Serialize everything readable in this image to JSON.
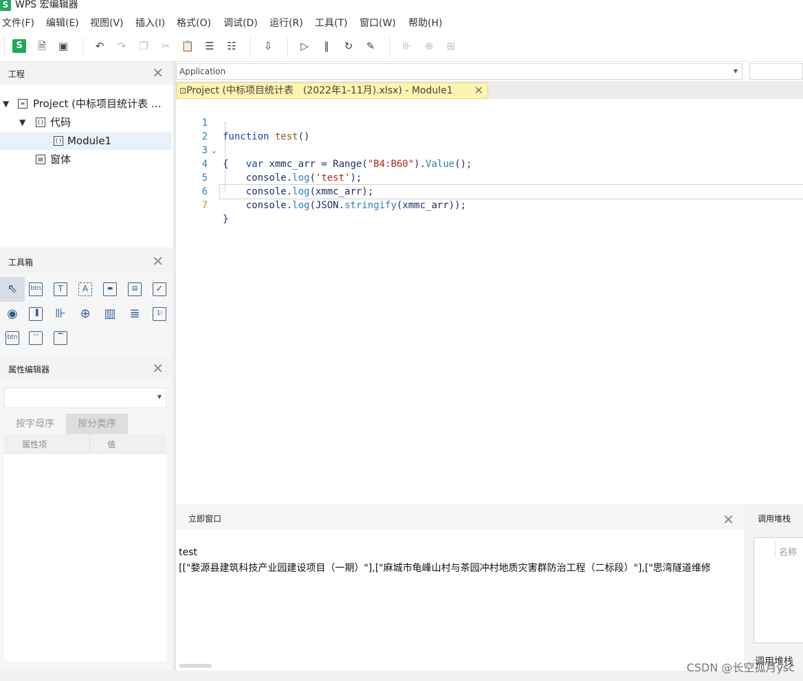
{
  "app": {
    "logo": "S",
    "title": "WPS 宏编辑器"
  },
  "menu": [
    {
      "label": "文件(F)"
    },
    {
      "label": "编辑(E)"
    },
    {
      "label": "视图(V)"
    },
    {
      "label": "插入(I)"
    },
    {
      "label": "格式(O)"
    },
    {
      "label": "调试(D)"
    },
    {
      "label": "运行(R)"
    },
    {
      "label": "工具(T)"
    },
    {
      "label": "窗口(W)"
    },
    {
      "label": "帮助(H)"
    }
  ],
  "toolbar": {
    "s_label": "S",
    "icons": [
      "new-file-icon",
      "save-icon",
      "undo-icon",
      "redo-icon",
      "copy-icon",
      "cut-icon",
      "paste-icon",
      "comment-icon",
      "uncomment-icon",
      "import-icon",
      "run-icon",
      "pause-icon",
      "reset-icon",
      "design-mode-icon",
      "align-left-icon",
      "align-center-icon",
      "distribute-icon"
    ]
  },
  "project_panel": {
    "title": "工程",
    "close": "✕",
    "tree": [
      {
        "label": "Project (中标项目统计表 …",
        "level": 0
      },
      {
        "label": "代码",
        "level": 1
      },
      {
        "label": "Module1",
        "level": 2,
        "selected": true
      },
      {
        "label": "窗体",
        "level": 1
      }
    ]
  },
  "toolbox_panel": {
    "title": "工具箱",
    "close": "✕",
    "tools": [
      "pointer",
      "command-button",
      "textbox",
      "label",
      "frame",
      "combobox",
      "checkbox",
      "option-button",
      "listbox",
      "spin-button",
      "scrollbar",
      "image",
      "tabstrip",
      "multipage",
      "toggle-button",
      "ref-edit",
      "userform"
    ]
  },
  "property_panel": {
    "title": "属性编辑器",
    "close": "✕",
    "tabs": [
      "按字母序",
      "按分类序"
    ],
    "columns": [
      "属性项",
      "值"
    ]
  },
  "editor": {
    "object_select": "Application",
    "tab_label": "Project (中标项目统计表　(2022年1-11月).xlsx) - Module1",
    "tab_close": "✕",
    "line_numbers": [
      "1",
      "2",
      "3",
      "4",
      "5",
      "6",
      "7"
    ]
  },
  "immediate": {
    "title": "立即窗口",
    "close": "✕",
    "output": [
      "test",
      "[[\"婺源县建筑科技产业园建设项目（一期）\"],[\"麻城市龟峰山村与茶园冲村地质灾害群防治工程（二标段）\"],[\"思湾隧道维修"
    ]
  },
  "callstack": {
    "title": "调用堆栈",
    "column": "名称",
    "bottom_tab": "调用堆栈"
  },
  "watermark": "CSDN @长空孤月ysc"
}
